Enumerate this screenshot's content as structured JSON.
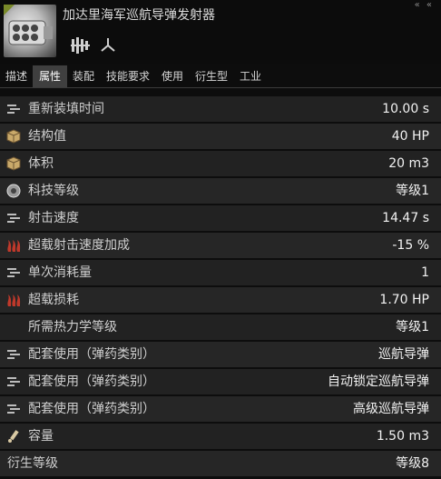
{
  "window": {
    "title": "加达里海军巡航导弹发射器",
    "corner_controls": "« «"
  },
  "tabs": [
    {
      "label": "描述",
      "active": false
    },
    {
      "label": "属性",
      "active": true
    },
    {
      "label": "装配",
      "active": false
    },
    {
      "label": "技能要求",
      "active": false
    },
    {
      "label": "使用",
      "active": false
    },
    {
      "label": "衍生型",
      "active": false
    },
    {
      "label": "工业",
      "active": false
    }
  ],
  "attributes": [
    {
      "icon": "reload-icon",
      "label": "重新装填时间",
      "value": "10.00 s"
    },
    {
      "icon": "structure-cube-icon",
      "label": "结构值",
      "value": "40 HP"
    },
    {
      "icon": "volume-cube-icon",
      "label": "体积",
      "value": "20 m3"
    },
    {
      "icon": "tech-level-icon",
      "label": "科技等级",
      "value": "等级1"
    },
    {
      "icon": "rate-of-fire-icon",
      "label": "射击速度",
      "value": "14.47 s"
    },
    {
      "icon": "overload-heat-icon",
      "label": "超载射击速度加成",
      "value": "-15 %"
    },
    {
      "icon": "charges-per-cycle-icon",
      "label": "单次消耗量",
      "value": "1"
    },
    {
      "icon": "overload-heat-icon",
      "label": "超载损耗",
      "value": "1.70 HP"
    },
    {
      "icon": "",
      "label": "所需热力学等级",
      "value": "等级1"
    },
    {
      "icon": "charge-group-icon",
      "label": "配套使用（弹药类别）",
      "value": "巡航导弹"
    },
    {
      "icon": "charge-group-icon",
      "label": "配套使用（弹药类别）",
      "value": "自动锁定巡航导弹"
    },
    {
      "icon": "charge-group-icon",
      "label": "配套使用（弹药类别）",
      "value": "高级巡航导弹"
    },
    {
      "icon": "capacity-icon",
      "label": "容量",
      "value": "1.50 m3"
    },
    {
      "icon": "",
      "label": "衍生等级",
      "value": "等级8"
    }
  ],
  "colors": {
    "background": "#0d0d0d",
    "row": "#222222",
    "active_tab": "#3f3f3f",
    "heat_icon": "#c0392b"
  }
}
